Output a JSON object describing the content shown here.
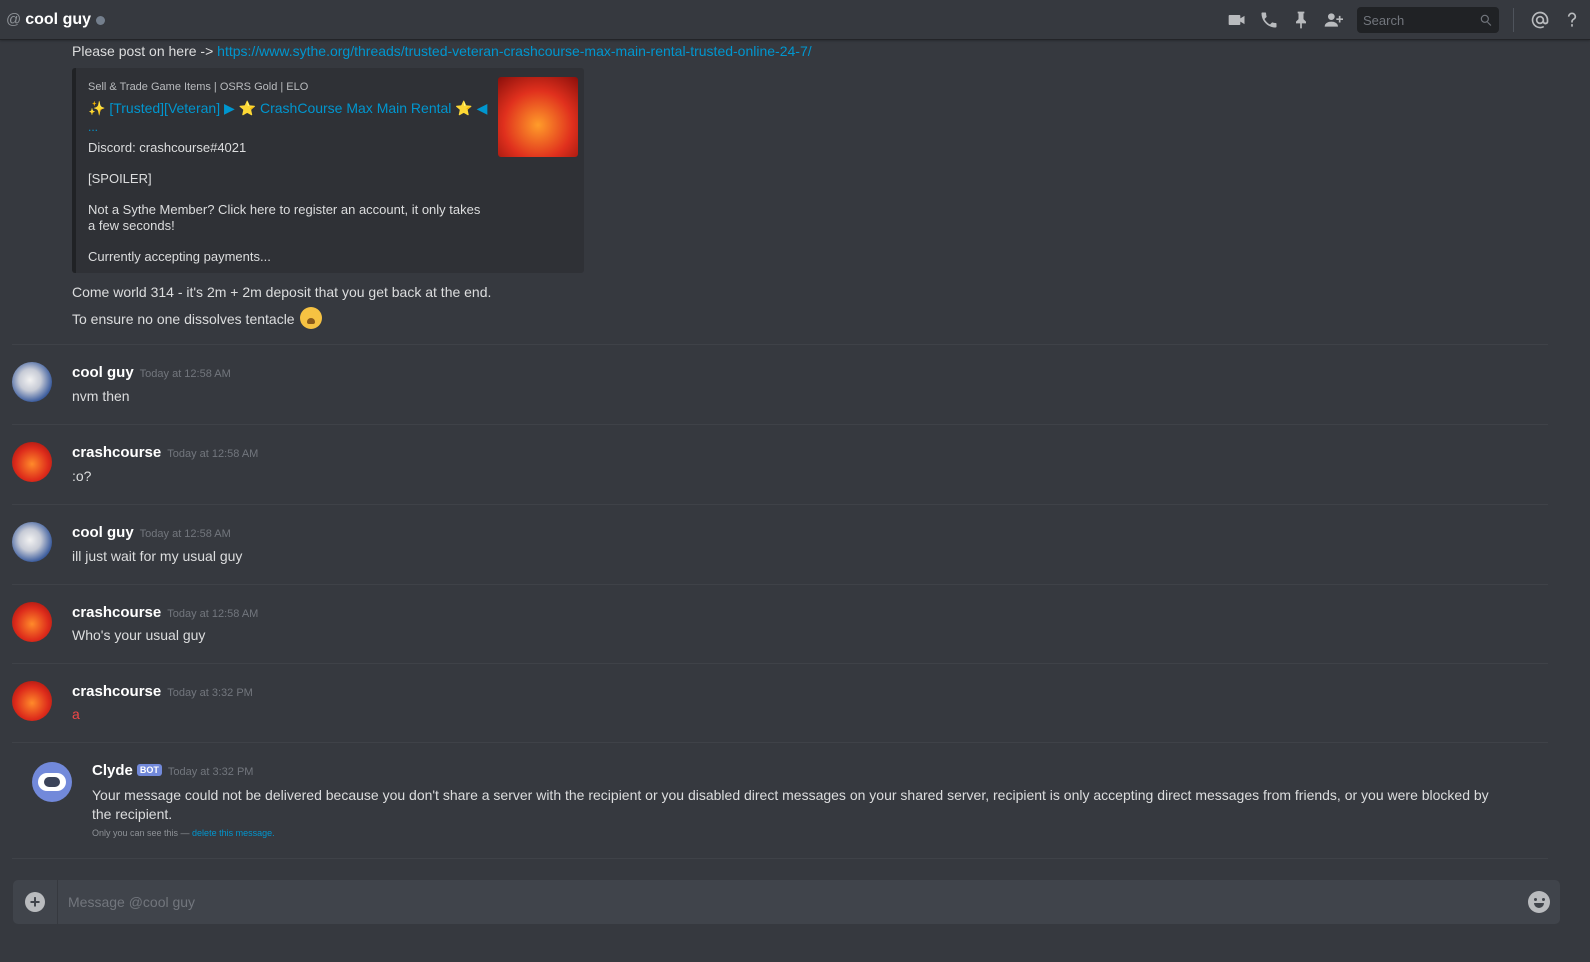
{
  "header": {
    "at": "@",
    "title": "cool guy",
    "search_placeholder": "Search",
    "icons": [
      "video-call-icon",
      "voice-call-icon",
      "pin-icon",
      "add-friend-icon",
      "search-icon",
      "mentions-icon",
      "help-icon"
    ]
  },
  "intro": {
    "prefix": "Please post on here -> ",
    "link": "https://www.sythe.org/threads/trusted-veteran-crashcourse-max-main-rental-trusted-online-24-7/"
  },
  "embed": {
    "provider": "Sell & Trade Game Items | OSRS Gold | ELO",
    "title_pre": "✨",
    "title_main": "[Trusted][Veteran]",
    "title_arrow1": "▶",
    "title_star1": "⭐",
    "title_name": "CrashCourse Max Main Rental",
    "title_star2": "⭐",
    "title_arrow2": "◀",
    "ellipsis": "...",
    "desc": [
      "Discord: crashcourse#4021",
      "[SPOILER]",
      "Not a Sythe Member? Click here to register an account, it only takes a few seconds!",
      "Currently accepting payments..."
    ]
  },
  "followups": [
    "Come world 314 - it's 2m + 2m deposit that you get back at the end.",
    "To ensure no one dissolves tentacle"
  ],
  "messages": [
    {
      "author": "cool guy",
      "time": "Today at 12:58 AM",
      "text": "nvm then"
    },
    {
      "author": "crashcourse",
      "time": "Today at 12:58 AM",
      "text": ":o?"
    },
    {
      "author": "cool guy",
      "time": "Today at 12:58 AM",
      "text": "ill just wait for my usual guy"
    },
    {
      "author": "crashcourse",
      "time": "Today at 12:58 AM",
      "text": "Who's your usual guy"
    },
    {
      "author": "crashcourse",
      "time": "Today at 3:32 PM",
      "text": "a"
    }
  ],
  "clyde": {
    "author": "Clyde",
    "badge": "BOT",
    "time": "Today at 3:32 PM",
    "text": "Your message could not be delivered because you don't share a server with the recipient or you disabled direct messages on your shared server, recipient is only accepting direct messages from friends, or you were blocked by the recipient.",
    "note_prefix": "Only you can see this — ",
    "note_link": "delete this message."
  },
  "composer": {
    "placeholder": "Message @cool guy"
  },
  "colors": {
    "background": "#36393f",
    "link": "#0096cf",
    "failed_message": "#f04747",
    "bot_badge": "#7289da"
  }
}
